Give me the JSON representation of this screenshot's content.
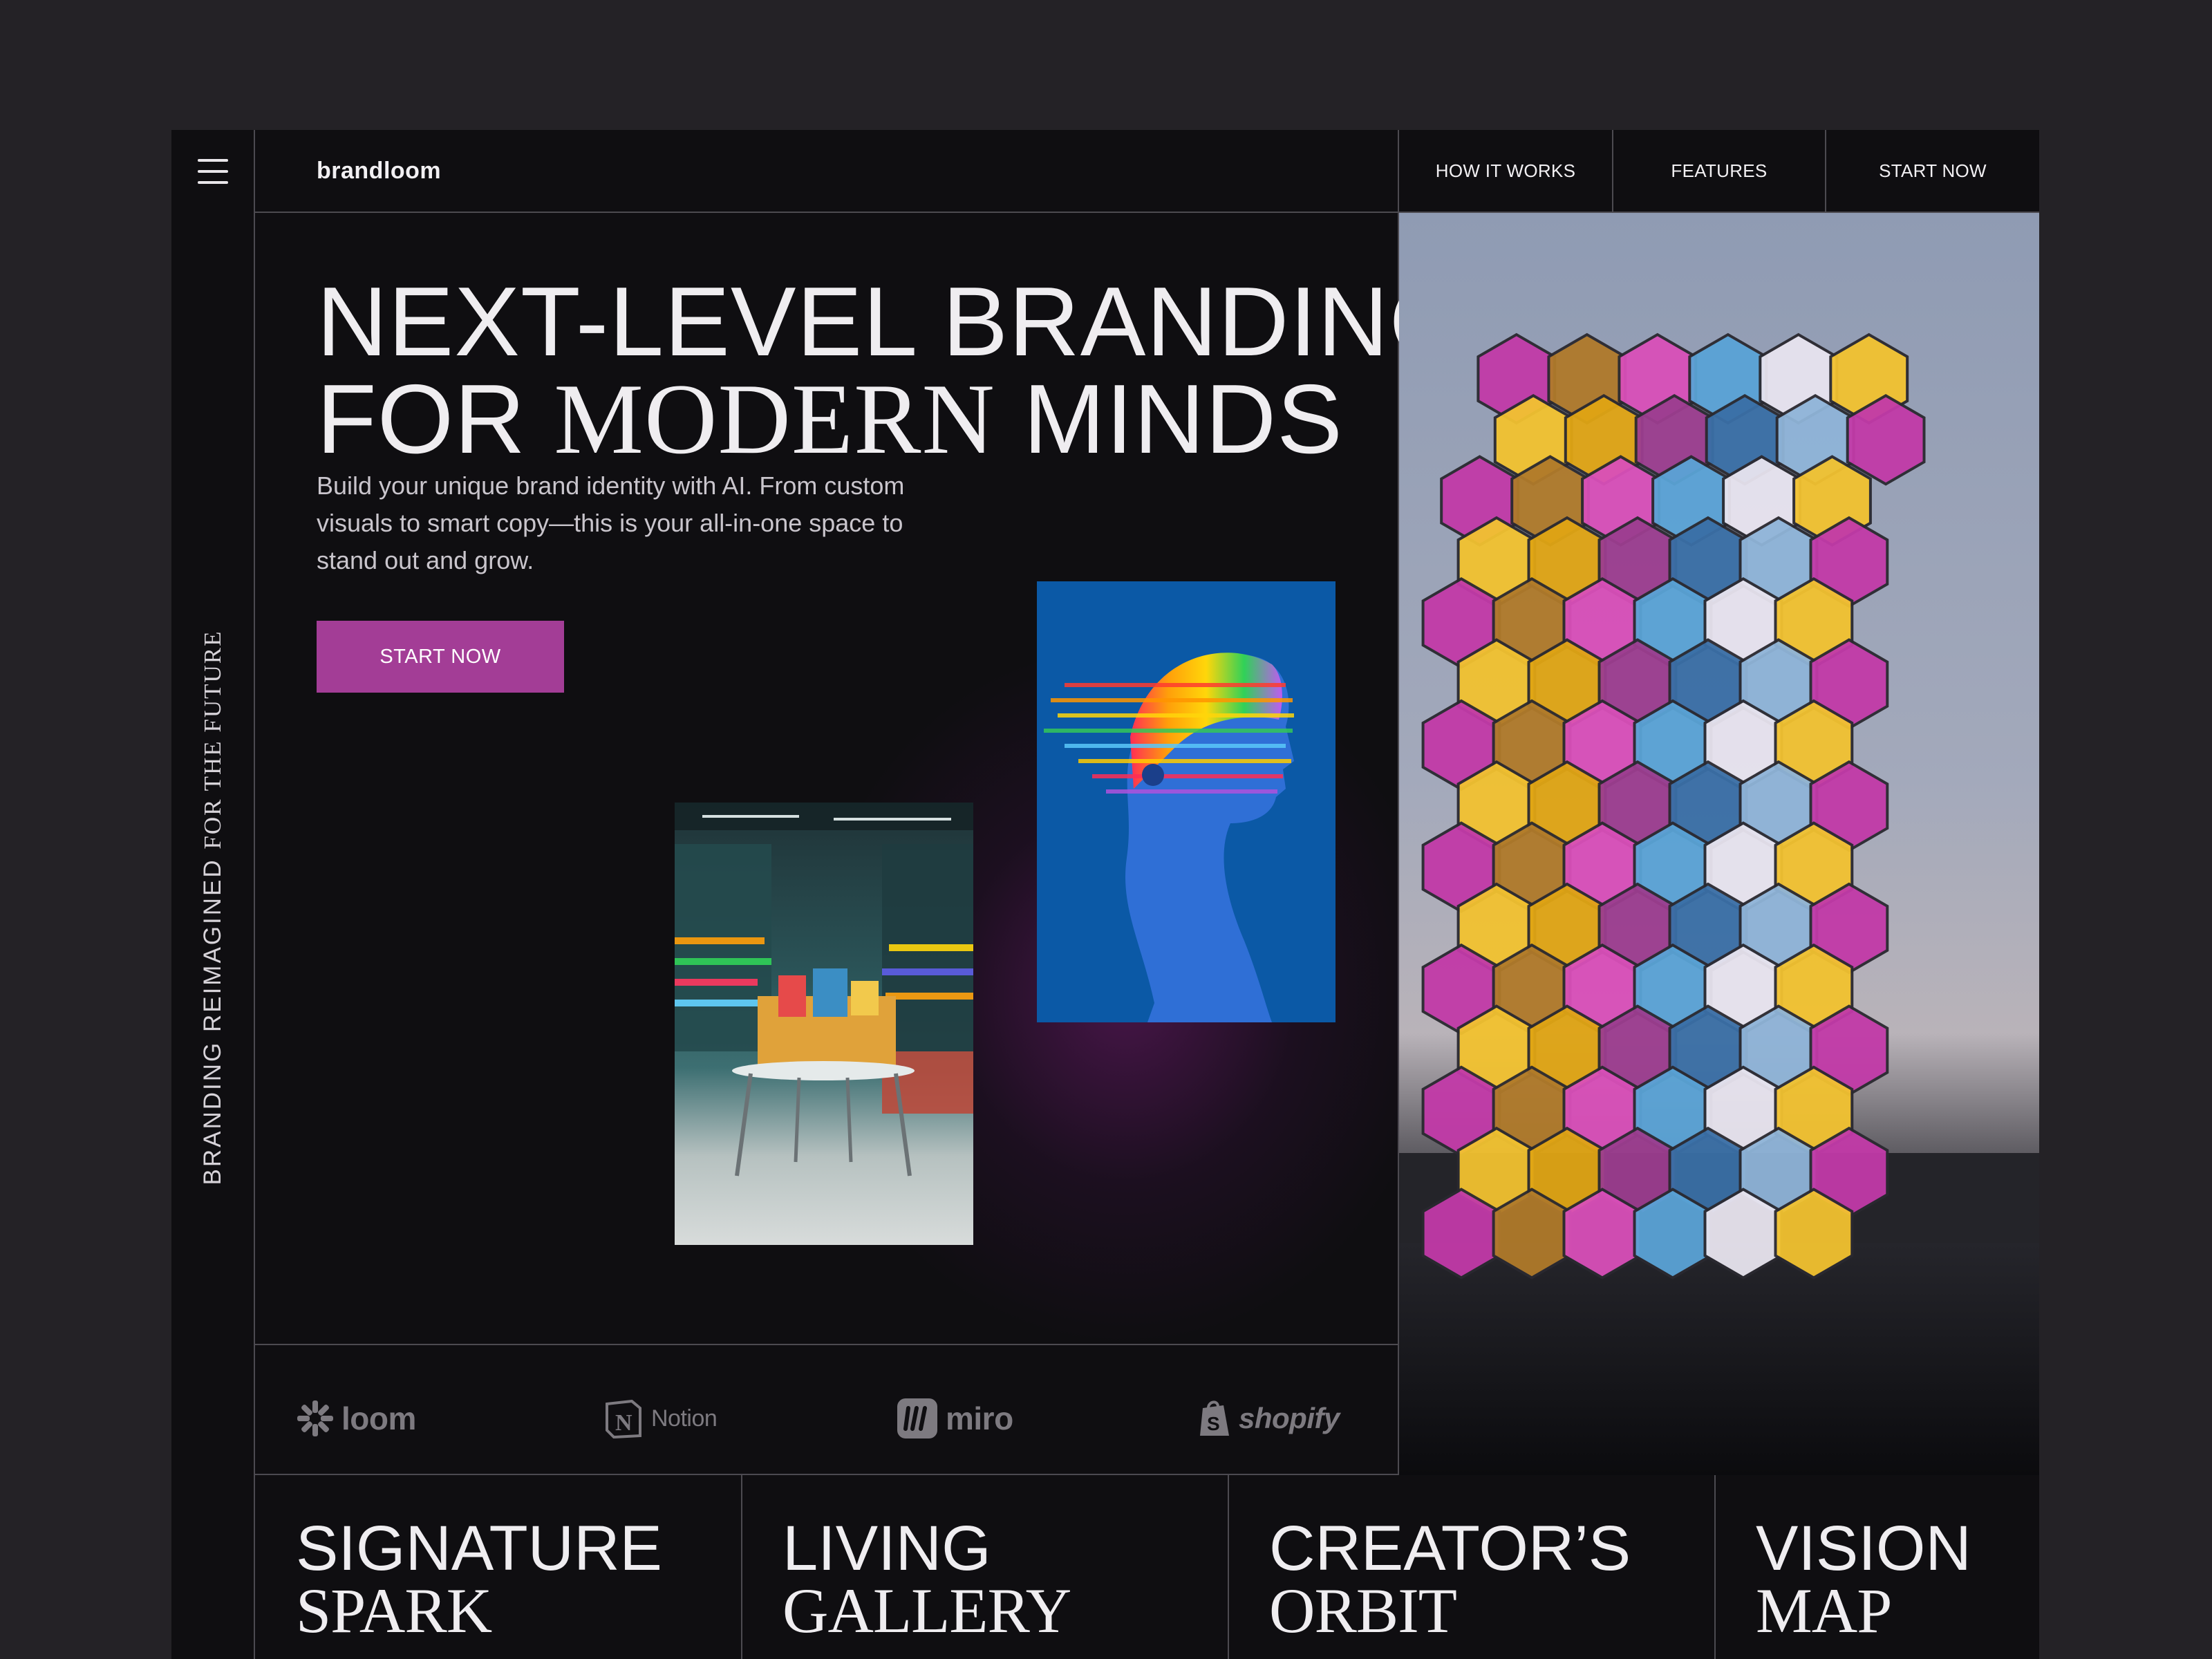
{
  "app": {
    "logo": "brandloom"
  },
  "nav": {
    "items": [
      {
        "label": "HOW IT WORKS"
      },
      {
        "label": "FEATURES"
      },
      {
        "label": "START NOW"
      }
    ]
  },
  "sidebar": {
    "tagline_a": "BRANDING REIMAGINED",
    "tagline_b": "FOR THE FUTURE"
  },
  "hero": {
    "title_line1": "NEXT-LEVEL BRANDING",
    "title_line2_a": "FOR",
    "title_line2_b": "MODERN",
    "title_line2_c": "MINDS",
    "subtitle": "Build your unique brand identity with AI. From custom visuals to smart copy—this is your all-in-one space to stand out and grow.",
    "cta_label": "START NOW"
  },
  "partners": [
    {
      "name": "loom",
      "icon": "loom-icon"
    },
    {
      "name": "Notion",
      "icon": "notion-icon"
    },
    {
      "name": "miro",
      "icon": "miro-icon"
    },
    {
      "name": "shopify",
      "icon": "shopify-icon"
    }
  ],
  "tiles": [
    {
      "line1": "SIGNATURE",
      "line2": "SPARK"
    },
    {
      "line1": "LIVING",
      "line2": "GALLERY"
    },
    {
      "line1": "CREATOR’S",
      "line2": "ORBIT"
    },
    {
      "line1": "VISION",
      "line2": "MAP"
    }
  ],
  "colors": {
    "accent": "#a33d96",
    "background": "#0f0e11",
    "page": "#242226",
    "divider": "#4c4a50"
  }
}
